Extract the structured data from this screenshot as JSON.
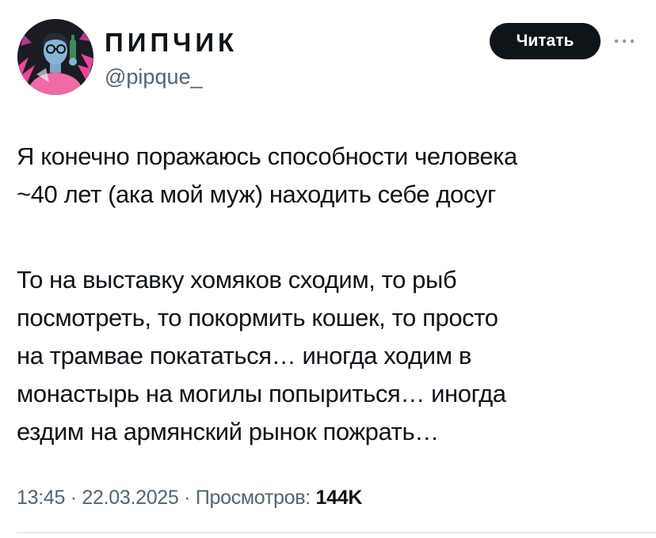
{
  "author": {
    "display_name": "ПИПЧИК",
    "handle": "@pipque_",
    "avatar_icon": "avatar-illustration-icon"
  },
  "header": {
    "follow_label": "Читать",
    "more_icon": "more-dots-icon"
  },
  "tweet": {
    "paragraphs": [
      [
        "Я конечно поражаюсь способности человека",
        "~40 лет (ака мой муж) находить себе досуг"
      ],
      [
        "То на выставку хомяков сходим, то рыб",
        "посмотреть, то покормить кошек, то просто",
        "на трамвае покататься… иногда ходим в",
        "монастырь на могилы попыриться… иногда",
        "ездим на армянский рынок пожрать…"
      ]
    ]
  },
  "meta": {
    "time": "13:45",
    "separator": " · ",
    "date": "22.03.2025",
    "views_label": "Просмотров:",
    "views_count": "144K"
  },
  "colors": {
    "text_primary": "#0f1419",
    "text_secondary": "#536471",
    "button_bg": "#0f1419",
    "avatar_pink": "#e8479a"
  }
}
